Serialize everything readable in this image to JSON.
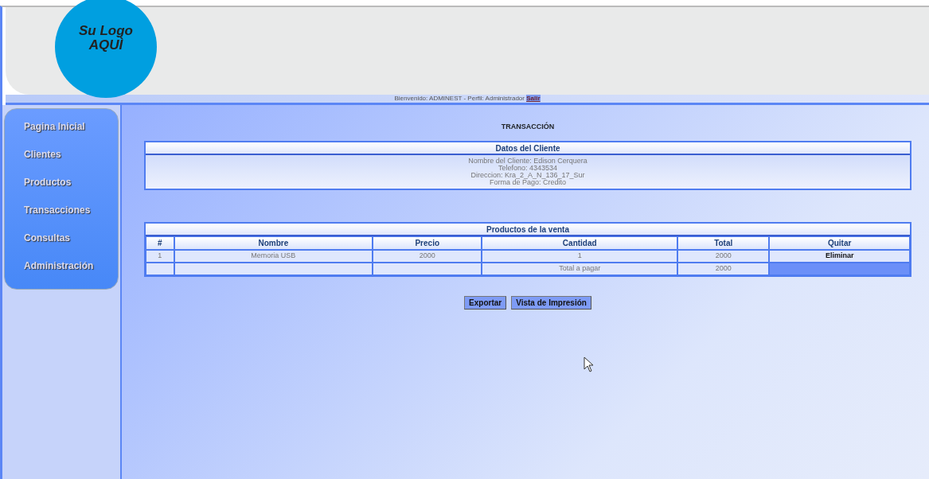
{
  "logo": {
    "line_1": "Su Logo",
    "line_2": "AQUÌ"
  },
  "welcome": {
    "text": "Bienvenido: ADMINEST - Perfil: Administrador",
    "logout": "Salir"
  },
  "sidebar": {
    "items": [
      {
        "label": "Pagina Inicial"
      },
      {
        "label": "Clientes"
      },
      {
        "label": "Productos"
      },
      {
        "label": "Transacciones"
      },
      {
        "label": "Consultas"
      },
      {
        "label": "Administración"
      }
    ]
  },
  "page_title": "TRANSACCIÓN",
  "client": {
    "title": "Datos del Cliente",
    "lines": [
      "Nombre del Cliente: Edison Cerquera",
      "Telefono: 4343534",
      "Direccion: Kra_2_A_N_136_17_Sur",
      "Forma de Pago: Credito"
    ]
  },
  "products": {
    "title": "Productos de la venta",
    "columns": [
      "#",
      "Nombre",
      "Precio",
      "Cantidad",
      "Total",
      "Quitar"
    ],
    "rows": [
      {
        "cells": [
          "1",
          "Memoria USB",
          "2000",
          "1",
          "2000"
        ],
        "action": "Eliminar"
      }
    ],
    "total_label": "Total a pagar",
    "total": "2000"
  },
  "buttons": [
    "Exportar",
    "Vista de Impresión"
  ]
}
